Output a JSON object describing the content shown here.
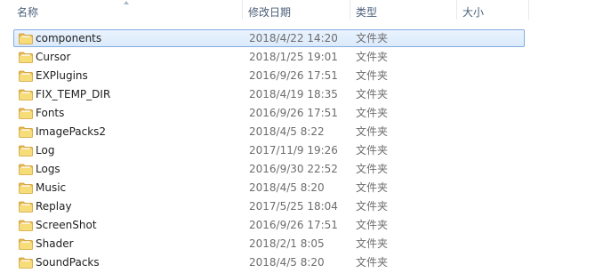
{
  "header": {
    "name_label": "名称",
    "date_label": "修改日期",
    "type_label": "类型",
    "size_label": "大小",
    "sort_icon": "sort-ascending-icon"
  },
  "colors": {
    "header_text": "#4c607a",
    "selection_fill": "#dbeafc",
    "selection_border": "#84acdd",
    "folder_yellow": "#f5d76e"
  },
  "rows": [
    {
      "name": "components",
      "date": "2018/4/22 14:20",
      "type": "文件夹",
      "selected": true
    },
    {
      "name": "Cursor",
      "date": "2018/1/25 19:01",
      "type": "文件夹"
    },
    {
      "name": "EXPlugins",
      "date": "2016/9/26 17:51",
      "type": "文件夹"
    },
    {
      "name": "FIX_TEMP_DIR",
      "date": "2018/4/19 18:35",
      "type": "文件夹"
    },
    {
      "name": "Fonts",
      "date": "2016/9/26 17:51",
      "type": "文件夹"
    },
    {
      "name": "ImagePacks2",
      "date": "2018/4/5 8:22",
      "type": "文件夹"
    },
    {
      "name": "Log",
      "date": "2017/11/9 19:26",
      "type": "文件夹"
    },
    {
      "name": "Logs",
      "date": "2016/9/30 22:52",
      "type": "文件夹"
    },
    {
      "name": "Music",
      "date": "2018/4/5 8:20",
      "type": "文件夹"
    },
    {
      "name": "Replay",
      "date": "2017/5/25 18:04",
      "type": "文件夹"
    },
    {
      "name": "ScreenShot",
      "date": "2016/9/26 17:51",
      "type": "文件夹"
    },
    {
      "name": "Shader",
      "date": "2018/2/1 8:05",
      "type": "文件夹"
    },
    {
      "name": "SoundPacks",
      "date": "2018/4/5 8:20",
      "type": "文件夹"
    }
  ]
}
